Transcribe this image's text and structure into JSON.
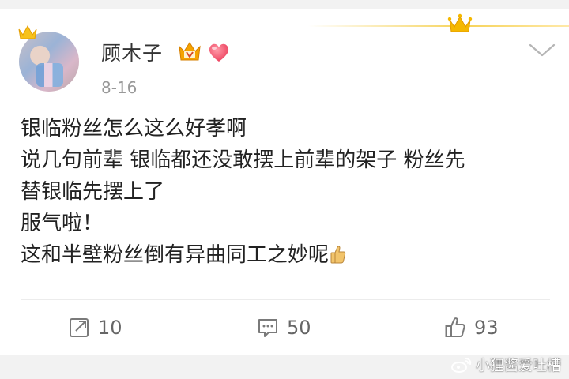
{
  "post": {
    "username": "顾木子",
    "date": "8-16",
    "lines": [
      "银临粉丝怎么这么好孝啊",
      "说几句前辈 银临都还没敢摆上前辈的架子 粉丝先",
      "替银临先摆上了",
      "服气啦！",
      "这和半壁粉丝倒有异曲同工之妙呢"
    ]
  },
  "actions": {
    "repost_count": "10",
    "comment_count": "50",
    "like_count": "93"
  },
  "watermark": {
    "text": "小狸酱爱吐槽"
  },
  "icons": {
    "avatar_crown": "crown-icon",
    "vip": "vip-crown-badge-icon",
    "heart": "heart-icon",
    "more": "chevron-down-icon",
    "thumb": "thumbs-up-emoji-icon",
    "repost": "repost-icon",
    "comment": "comment-icon",
    "like": "like-icon",
    "weibo": "weibo-logo-icon"
  },
  "colors": {
    "accent_gold": "#f5b800",
    "heart_red": "#f0566a",
    "text": "#222222",
    "muted": "#999999"
  }
}
